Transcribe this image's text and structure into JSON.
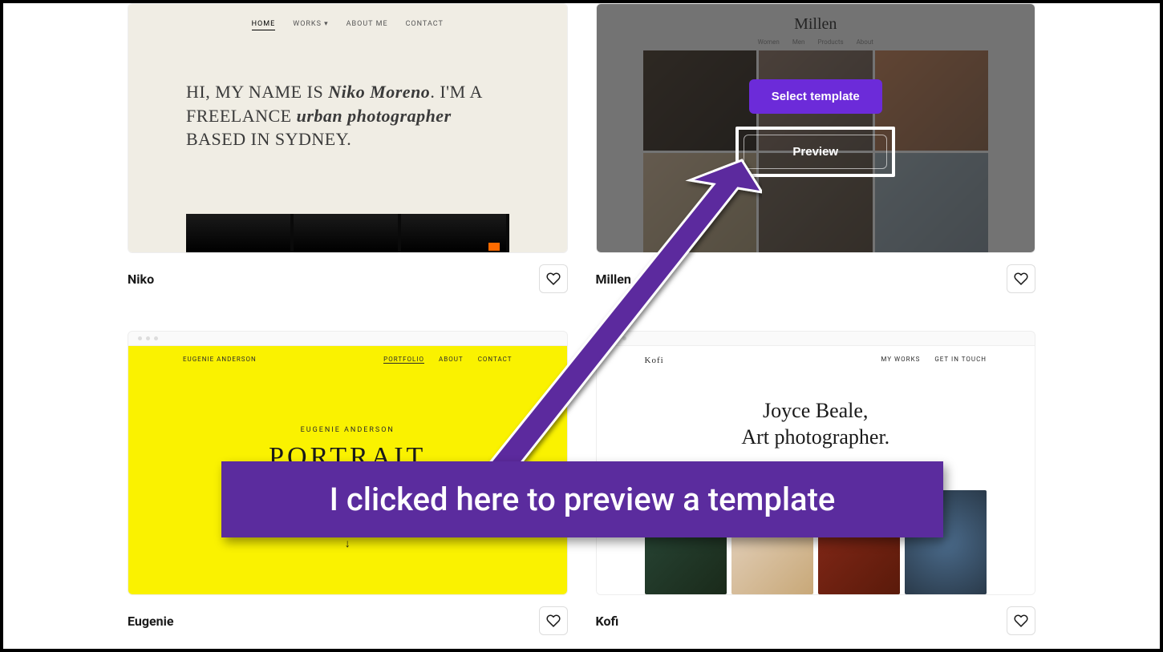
{
  "templates": [
    {
      "name": "Niko",
      "nav": [
        "HOME",
        "WORKS ▾",
        "ABOUT ME",
        "CONTACT"
      ],
      "hero_prefix": "HI, MY NAME IS ",
      "hero_name": "Niko Moreno",
      "hero_mid": ". I'M A FREELANCE ",
      "hero_role": "urban photographer",
      "hero_suffix": " BASED IN SYDNEY."
    },
    {
      "name": "Millen",
      "title": "Millen",
      "nav": [
        "Women",
        "Men",
        "Products",
        "About"
      ],
      "select_label": "Select template",
      "preview_label": "Preview"
    },
    {
      "name": "Eugenie",
      "brand": "EUGENIE ANDERSON",
      "nav": [
        "PORTFOLIO",
        "ABOUT",
        "CONTACT"
      ],
      "sub": "EUGENIE ANDERSON",
      "big": "PORTRAIT",
      "arrow_glyph": "↓"
    },
    {
      "name": "Kofi",
      "brand": "Kofi",
      "nav": [
        "MY WORKS",
        "GET IN TOUCH"
      ],
      "hero_line1": "Joyce Beale,",
      "hero_line2": "Art photographer."
    }
  ],
  "annotation": "I clicked here to preview a template",
  "colors": {
    "accent_purple": "#6c2bd9",
    "annotation_bg": "#5b2c9e"
  }
}
